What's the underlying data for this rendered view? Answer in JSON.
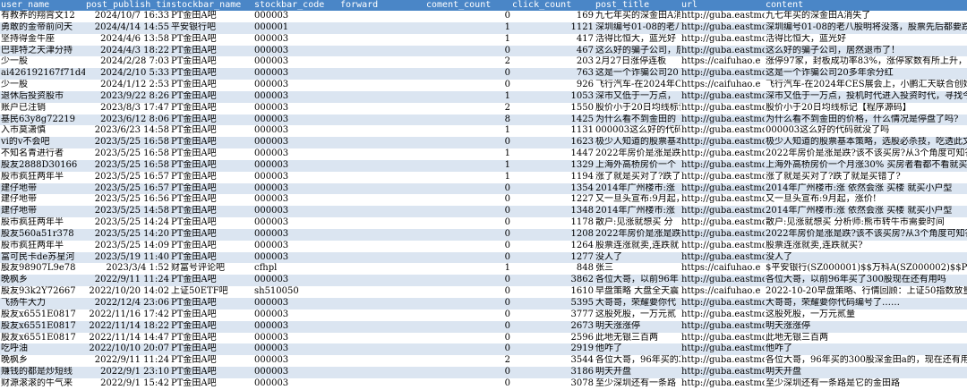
{
  "headers": [
    "user_name",
    "post_publish_time",
    "stockbar_name",
    "stockbar_code",
    "forward",
    "coment_count",
    "click_count",
    "post_title",
    "url",
    "content"
  ],
  "rows": [
    [
      "有教养的翔霄文12",
      "2024/10/7 16:33",
      "PT金田A吧",
      "000003",
      "",
      "0",
      "169",
      "九七年买的深金田A消失了",
      "http://guba.eastmo",
      "九七年买的深金田A消失了"
    ],
    [
      "勇敢的金帝前问天",
      "2024/4/14 14:55",
      "平安银行吧",
      "000001",
      "",
      "1",
      "1121",
      "深圳编号01-08的老八",
      "http://guba.eastmo",
      "深圳编号01-08的老八股明将没落，股票先后都要跌"
    ],
    [
      "坚持得金牛座",
      "2024/4/6 13:58",
      "PT金田A吧",
      "000003",
      "",
      "1",
      "417",
      "活得比恒大，蓝光好",
      "http://guba.eastmo",
      "活得比恒大，蓝光好"
    ],
    [
      "巴菲特之天津分持",
      "2024/4/3 18:22",
      "PT金田A吧",
      "000003",
      "",
      "0",
      "467",
      "这么好的骗子公司，居",
      "http://guba.eastmo",
      "这么好的骗子公司，居然退市了！"
    ],
    [
      "少一股",
      "2024/2/28 7:03",
      "PT金田A吧",
      "000003",
      "",
      "2",
      "203",
      "2月27日涨停连板",
      "https://caifuhao.e",
      "涨停97家，封板成功率83%，涨停家数有所上升，封"
    ],
    [
      "ai426192167f71d4",
      "2024/2/10 5:33",
      "PT金田A吧",
      "000003",
      "",
      "0",
      "763",
      "这是一个诈骗公司20",
      "http://guba.eastmo",
      "这是一个诈骗公司20多年余分红"
    ],
    [
      "少一股",
      "2024/1/12 2:53",
      "PT金田A吧",
      "000003",
      "",
      "0",
      "926",
      "飞行汽车-在2024年C",
      "https://caifuhao.e",
      "飞行汽车-在2024年CES展会上，小鹏汇天联合创始人"
    ],
    [
      "退休后投资股市",
      "2023/9/22 8:26",
      "PT金田A吧",
      "000003",
      "",
      "1",
      "1053",
      "深市又低于一万点，",
      "http://guba.eastmo",
      "深市又低于一万点，投机时代进入投资时代，寻找今"
    ],
    [
      "账户已注销",
      "2023/8/3 17:47",
      "PT金田A吧",
      "000003",
      "",
      "2",
      "1550",
      "股价小于20日均线标记",
      "http://guba.eastmo",
      "股价小于20日均线标记【程序源码】"
    ],
    [
      "基民63y8g72219",
      "2023/6/12 8:06",
      "PT金田A吧",
      "000003",
      "",
      "8",
      "1425",
      "为什么看不到金田的",
      "http://guba.eastmo",
      "为什么看不到金田的价格，什么情况是停盘了吗?"
    ],
    [
      "入市莫潇慎",
      "2023/6/23 14:58",
      "PT金田A吧",
      "000003",
      "",
      "1",
      "1131",
      "000003这么好的代码",
      "http://guba.eastmo",
      "000003这么好的代码就没了吗"
    ],
    [
      "vi的v不会吧",
      "2023/5/25 16:58",
      "PT金田A吧",
      "000003",
      "",
      "0",
      "1623",
      "极少人知道的股票基本",
      "http://guba.eastmo",
      "极少人知道的股票基本策略，选股必杀技，吃透此文就"
    ],
    [
      "不知名青进行者",
      "2023/5/25 16:58",
      "PT金田A吧",
      "000003",
      "",
      "1",
      "1447",
      "2022年房价是涨是跌?",
      "http://guba.eastmo",
      "2022年房价是涨是跌?该不该买房?从3个角度可知答"
    ],
    [
      "股友2888D30166",
      "2023/5/25 16:58",
      "PT金田A吧",
      "000003",
      "",
      "1",
      "1329",
      "上海外高桥房价一个",
      "http://guba.eastmo",
      "上海外高桥房价一个月涨30% 买房者看都不看就买了"
    ],
    [
      "股市疯狂两年半",
      "2023/5/25 16:57",
      "PT金田A吧",
      "000003",
      "",
      "1",
      "1194",
      "涨了就是买对了?跌了",
      "http://guba.eastmo",
      "涨了就是买对了?跌了就是买错了?"
    ],
    [
      "建仔地带",
      "2023/5/25 16:57",
      "PT金田A吧",
      "000003",
      "",
      "0",
      "1354",
      "2014年广州楼市:涨",
      "http://guba.eastmo",
      "2014年广州楼市:涨 依然会涨 买楼 就买小户型"
    ],
    [
      "建仔地带",
      "2023/5/25 16:56",
      "PT金田A吧",
      "000003",
      "",
      "0",
      "1227",
      "又一旦头宣布:9月起，",
      "http://guba.eastmo",
      "又一旦头宣布:9月起，涨价!"
    ],
    [
      "建仔地带",
      "2023/5/25 14:58",
      "PT金田A吧",
      "000003",
      "",
      "0",
      "1348",
      "2014年广州楼市:涨",
      "http://guba.eastmo",
      "2014年广州楼市:涨 依然会涨 买楼 就买小户型"
    ],
    [
      "股市疯狂两年半",
      "2023/5/25 14:24",
      "PT金田A吧",
      "000003",
      "",
      "0",
      "1178",
      "散户:见涨就想买 分",
      "http://guba.eastmo",
      "散户:见涨就想买 分析师:熊市转牛市需要时间"
    ],
    [
      "股友560a51r378",
      "2023/5/25 14:20",
      "PT金田A吧",
      "000003",
      "",
      "0",
      "1208",
      "2022年房价是涨是跌?",
      "http://guba.eastmo",
      "2022年房价是涨是跌?该不该买房?从3个角度可知答"
    ],
    [
      "股市疯狂两年半",
      "2023/5/25 14:09",
      "PT金田A吧",
      "000003",
      "",
      "0",
      "1264",
      "股票连涨就卖,连跌就",
      "http://guba.eastmo",
      "股票连涨就卖,连跌就买?"
    ],
    [
      "富可民卡de苏星河",
      "2023/5/19 11:40",
      "PT金田A吧",
      "000003",
      "",
      "0",
      "1277",
      "没人了",
      "http://guba.eastmo",
      "没人了"
    ],
    [
      "股友98907L9e78",
      "2023/3/4 1:52",
      "财富号评论吧",
      "cfhpl",
      "",
      "1",
      "848",
      "张三",
      "https://caifuhao.e",
      "$平安银行(SZ000001)$$万科A(SZ000002)$$PT金田A"
    ],
    [
      "晚枫乡",
      "2022/9/11 11:24",
      "PT金田A吧",
      "000003",
      "",
      "0",
      "3862",
      "各位大哥，以前96年",
      "http://guba.eastmo",
      "各位大哥，以前96年买了300股现在还有用吗"
    ],
    [
      "股友93k2Y72667",
      "2022/10/20 14:02",
      "上证50ETF吧",
      "sh510050",
      "",
      "0",
      "1610",
      "早盘策略 大盘全天震",
      "https://caifuhao.e",
      "2022-10-20早盘策略、行情回顾：上证50指数放量"
    ],
    [
      "飞扬牛大力",
      "2022/12/4 23:06",
      "PT金田A吧",
      "000003",
      "",
      "0",
      "5395",
      "大哥哥，荣耀要你代",
      "http://guba.eastmo",
      "大哥哥，荣耀要你代码编号了……"
    ],
    [
      "股友x6551E0817",
      "2022/11/16 17:42",
      "PT金田A吧",
      "000003",
      "",
      "0",
      "3777",
      "这股死股，一万元贰",
      "http://guba.eastmo",
      "这股死股，一万元贰量"
    ],
    [
      "股友x6551E0817",
      "2022/11/14 18:22",
      "PT金田A吧",
      "000003",
      "",
      "0",
      "2673",
      "明天涨涨停",
      "http://guba.eastmo",
      "明天涨涨停"
    ],
    [
      "股友x6551E0817",
      "2022/11/14 14:47",
      "PT金田A吧",
      "000003",
      "",
      "0",
      "2596",
      "此地无银三百两",
      "http://guba.eastmo",
      "此地无银三百两"
    ],
    [
      "吃呼油",
      "2022/10/10 20:07",
      "PT金田A吧",
      "000003",
      "",
      "0",
      "2919",
      "他咋了",
      "http://guba.eastmo",
      "他咋了"
    ],
    [
      "晚枫乡",
      "2022/9/11 11:24",
      "PT金田A吧",
      "000003",
      "",
      "2",
      "3544",
      "各位大哥，96年买的3",
      "http://guba.eastmo",
      "各位大哥，96年买的300股深金田a的，现在还有用吗"
    ],
    [
      "赚钱的都是炒短线",
      "2022/9/1 23:10",
      "PT金田A吧",
      "000003",
      "",
      "0",
      "3186",
      "明天开盘",
      "http://guba.eastmo",
      "明天开盘"
    ],
    [
      "财源滚滚的牛气来",
      "2022/9/1 15:42",
      "PT金田A吧",
      "000003",
      "",
      "0",
      "3078",
      "至少深圳还有一条路",
      "http://guba.eastmo",
      "至少深圳还有一条路是它的金田路"
    ]
  ]
}
